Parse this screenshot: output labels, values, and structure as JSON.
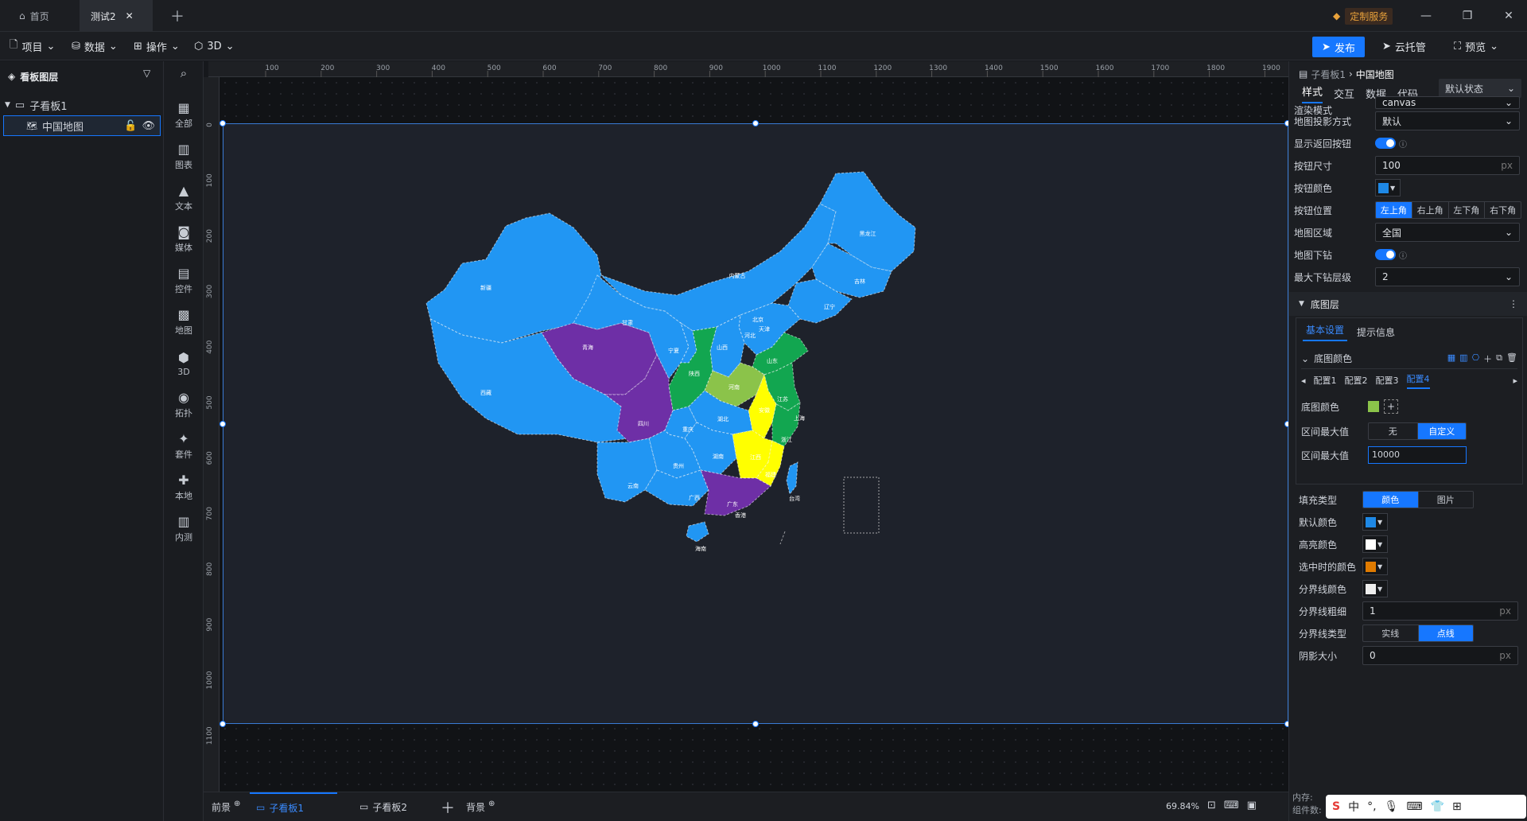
{
  "titlebar": {
    "tabs": [
      {
        "label": "首页"
      },
      {
        "label": "测试2"
      }
    ],
    "custom_service": "定制服务"
  },
  "toolbar": {
    "menus": [
      {
        "label": "项目"
      },
      {
        "label": "数据"
      },
      {
        "label": "操作"
      },
      {
        "label": "3D"
      }
    ],
    "publish": "发布",
    "cloud": "云托管",
    "preview": "预览"
  },
  "layers": {
    "title": "看板图层",
    "board": "子看板1",
    "layer": "中国地图"
  },
  "components": [
    {
      "label": "全部",
      "icon": "grid-icon"
    },
    {
      "label": "图表",
      "icon": "chart-icon"
    },
    {
      "label": "文本",
      "icon": "text-icon"
    },
    {
      "label": "媒体",
      "icon": "media-icon"
    },
    {
      "label": "控件",
      "icon": "control-icon"
    },
    {
      "label": "地图",
      "icon": "map-icon"
    },
    {
      "label": "3D",
      "icon": "cube-icon"
    },
    {
      "label": "拓扑",
      "icon": "topology-icon"
    },
    {
      "label": "套件",
      "icon": "kit-icon"
    },
    {
      "label": "本地",
      "icon": "local-icon"
    },
    {
      "label": "内测",
      "icon": "beta-icon"
    }
  ],
  "ruler": {
    "top": [
      "100",
      "200",
      "300",
      "400",
      "500",
      "600",
      "700",
      "800",
      "900",
      "1000",
      "1100",
      "1200",
      "1300",
      "1400",
      "1500",
      "1600",
      "1700",
      "1800",
      "1900"
    ],
    "left": [
      "0",
      "100",
      "200",
      "300",
      "400",
      "500",
      "600",
      "700",
      "800",
      "900",
      "1000",
      "1100"
    ]
  },
  "map": {
    "provinces": [
      "新疆",
      "西藏",
      "青海",
      "甘肃",
      "内蒙古",
      "黑龙江",
      "吉林",
      "辽宁",
      "北京",
      "天津",
      "河北",
      "山西",
      "山东",
      "宁夏",
      "陕西",
      "河南",
      "江苏",
      "安徽",
      "上海",
      "湖北",
      "四川",
      "重庆",
      "浙江",
      "湖南",
      "江西",
      "贵州",
      "福建",
      "云南",
      "广西",
      "广东",
      "台湾",
      "香港",
      "海南"
    ]
  },
  "bottombar": {
    "foreground": "前景",
    "tabs": [
      "子看板1",
      "子看板2"
    ],
    "background": "背景",
    "zoom": "69.84%",
    "memory": "内存:",
    "components": "组件数:"
  },
  "props": {
    "breadcrumb_parent": "子看板1",
    "breadcrumb_current": "中国地图",
    "tabs": [
      "样式",
      "交互",
      "数据",
      "代码"
    ],
    "state": "默认状态",
    "rows": {
      "render_mode_label": "渲染模式",
      "render_mode_value": "canvas",
      "projection_label": "地图投影方式",
      "projection_value": "默认",
      "show_back_label": "显示返回按钮",
      "button_size_label": "按钮尺寸",
      "button_size_value": "100",
      "button_color_label": "按钮颜色",
      "button_pos_label": "按钮位置",
      "button_pos_options": [
        "左上角",
        "右上角",
        "左下角",
        "右下角"
      ],
      "region_label": "地图区域",
      "region_value": "全国",
      "drill_label": "地图下钻",
      "max_drill_label": "最大下钻层级",
      "max_drill_value": "2",
      "unit_px": "px"
    },
    "base_layer": {
      "title": "底图层",
      "subtabs": [
        "基本设置",
        "提示信息"
      ],
      "color_group": "底图颜色",
      "configs": [
        "配置1",
        "配置2",
        "配置3",
        "配置4"
      ],
      "base_color_label": "底图颜色",
      "range_max_label": "区间最大值",
      "range_max_options": [
        "无",
        "自定义"
      ],
      "range_max_value_label": "区间最大值",
      "range_max_value": "10000",
      "fill_type_label": "填充类型",
      "fill_type_options": [
        "颜色",
        "图片"
      ],
      "default_color_label": "默认颜色",
      "highlight_color_label": "高亮颜色",
      "selected_color_label": "选中时的颜色",
      "border_color_label": "分界线颜色",
      "border_width_label": "分界线粗细",
      "border_width_value": "1",
      "border_type_label": "分界线类型",
      "border_type_options": [
        "实线",
        "点线"
      ],
      "shadow_label": "阴影大小",
      "shadow_value": "0"
    }
  },
  "colors": {
    "accent": "#1677ff",
    "map_blue": "#2196f3",
    "map_purple": "#6e2fa6",
    "map_green": "#12a650",
    "map_light_green": "#8bc34a",
    "map_yellow": "#ffff00",
    "default_color": "#1e88e5",
    "highlight_color": "#ffffff",
    "selected_color": "#e07b00",
    "border_color": "#ffffff"
  },
  "ime": {
    "items": [
      "中",
      "°,"
    ]
  }
}
